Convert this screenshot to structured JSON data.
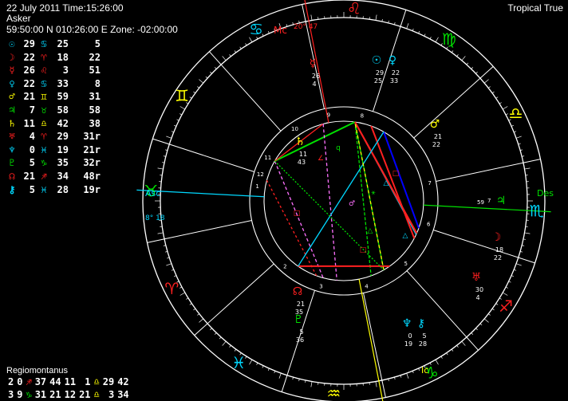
{
  "header": {
    "line1": "22 July 2011 Time:15:26:00",
    "line2": "Asker",
    "line3": "59:50:00 N 010:26:00 E Zone: -02:00:00",
    "zodiac": "Tropical True"
  },
  "colors": {
    "background": "#000000",
    "cyan": "#00d8ff",
    "red": "#ff2020",
    "yellow": "#ffff00",
    "green": "#00e000",
    "pink": "#ff70ff",
    "white": "#ffffff"
  },
  "planets": [
    {
      "glyph": "☉",
      "name": "sun-icon",
      "color": "#00d8ff",
      "deg": "29",
      "sign": "♋",
      "sign_color": "#00d8ff",
      "min": "25",
      "sec": "5"
    },
    {
      "glyph": "☽",
      "name": "moon-icon",
      "color": "#ff2020",
      "deg": "22",
      "sign": "♈",
      "sign_color": "#ff2020",
      "min": "18",
      "sec": "22"
    },
    {
      "glyph": "☿",
      "name": "mercury-icon",
      "color": "#ff2020",
      "deg": "26",
      "sign": "♌",
      "sign_color": "#ff2020",
      "min": "3",
      "sec": "51"
    },
    {
      "glyph": "♀",
      "name": "venus-icon",
      "color": "#00d8ff",
      "deg": "22",
      "sign": "♋",
      "sign_color": "#00d8ff",
      "min": "33",
      "sec": "8"
    },
    {
      "glyph": "♂",
      "name": "mars-icon",
      "color": "#ffff00",
      "deg": "21",
      "sign": "♊",
      "sign_color": "#ffff00",
      "min": "59",
      "sec": "31"
    },
    {
      "glyph": "♃",
      "name": "jupiter-icon",
      "color": "#00e000",
      "deg": "7",
      "sign": "♉",
      "sign_color": "#00e000",
      "min": "58",
      "sec": "58"
    },
    {
      "glyph": "♄",
      "name": "saturn-icon",
      "color": "#ffff00",
      "deg": "11",
      "sign": "♎",
      "sign_color": "#ffff00",
      "min": "42",
      "sec": "38"
    },
    {
      "glyph": "♅",
      "name": "uranus-icon",
      "color": "#ff2020",
      "deg": "4",
      "sign": "♈",
      "sign_color": "#ff2020",
      "min": "29",
      "sec": "31r"
    },
    {
      "glyph": "♆",
      "name": "neptune-icon",
      "color": "#00d8ff",
      "deg": "0",
      "sign": "♓",
      "sign_color": "#00d8ff",
      "min": "19",
      "sec": "21r"
    },
    {
      "glyph": "♇",
      "name": "pluto-icon",
      "color": "#00e000",
      "deg": "5",
      "sign": "♑",
      "sign_color": "#00e000",
      "min": "35",
      "sec": "32r"
    },
    {
      "glyph": "☊",
      "name": "node-icon",
      "color": "#ff2020",
      "deg": "21",
      "sign": "♐",
      "sign_color": "#ff2020",
      "min": "34",
      "sec": "48r"
    },
    {
      "glyph": "⚷",
      "name": "chiron-icon",
      "color": "#00d8ff",
      "deg": "5",
      "sign": "♓",
      "sign_color": "#00d8ff",
      "min": "28",
      "sec": "19r"
    }
  ],
  "house_system": "Regiomontanus",
  "cusps": [
    [
      {
        "t": "2",
        "c": "#ffffff"
      },
      {
        "t": "0",
        "c": "#ffffff"
      },
      {
        "t": "♐",
        "c": "#ff2020"
      },
      {
        "t": "37",
        "c": "#ffffff"
      },
      {
        "t": "44",
        "c": "#ffffff"
      },
      {
        "t": "11",
        "c": "#ffffff"
      },
      {
        "t": "1",
        "c": "#ffffff"
      },
      {
        "t": "♎",
        "c": "#ffff00"
      },
      {
        "t": "29",
        "c": "#ffffff"
      },
      {
        "t": "42",
        "c": "#ffffff"
      }
    ],
    [
      {
        "t": "3",
        "c": "#ffffff"
      },
      {
        "t": "9",
        "c": "#ffffff"
      },
      {
        "t": "♑",
        "c": "#00e000"
      },
      {
        "t": "31",
        "c": "#ffffff"
      },
      {
        "t": "21",
        "c": "#ffffff"
      },
      {
        "t": "12",
        "c": "#ffffff"
      },
      {
        "t": "21",
        "c": "#ffffff"
      },
      {
        "t": "♎",
        "c": "#ffff00"
      },
      {
        "t": "3",
        "c": "#ffffff"
      },
      {
        "t": "34",
        "c": "#ffffff"
      }
    ]
  ],
  "chart": {
    "mc_label": "Mc",
    "mc_pos": "20° 47",
    "asc_label": "Asc",
    "asc_pos": "8° 18",
    "des_label": "Des",
    "ic_label": "Ic",
    "des_deg": "59",
    "des_min": "7",
    "zodiac_signs": [
      {
        "g": "♌",
        "c": "#ff2020",
        "name": "leo-sign-icon"
      },
      {
        "g": "♋",
        "c": "#00d8ff",
        "name": "cancer-sign-icon"
      },
      {
        "g": "♊",
        "c": "#ffff00",
        "name": "gemini-sign-icon"
      },
      {
        "g": "♉",
        "c": "#00e000",
        "name": "taurus-sign-icon"
      },
      {
        "g": "♈",
        "c": "#ff2020",
        "name": "aries-sign-icon"
      },
      {
        "g": "♓",
        "c": "#00d8ff",
        "name": "pisces-sign-icon"
      },
      {
        "g": "♒",
        "c": "#ffff00",
        "name": "aquarius-sign-icon"
      },
      {
        "g": "♑",
        "c": "#00e000",
        "name": "capricorn-sign-icon"
      },
      {
        "g": "♐",
        "c": "#ff2020",
        "name": "sagittarius-sign-icon"
      },
      {
        "g": "♏",
        "c": "#00d8ff",
        "name": "scorpio-sign-icon"
      },
      {
        "g": "♎",
        "c": "#ffff00",
        "name": "libra-sign-icon"
      },
      {
        "g": "♍",
        "c": "#00e000",
        "name": "virgo-sign-icon"
      }
    ],
    "house_numbers": [
      "1",
      "2",
      "3",
      "4",
      "5",
      "6",
      "7",
      "8",
      "9",
      "10",
      "11",
      "12"
    ],
    "wheel_planets": [
      {
        "g": "☿",
        "c": "#ff2020",
        "name": "wheel-mercury",
        "deg": "26",
        "min": "4"
      },
      {
        "g": "☉",
        "c": "#00d8ff",
        "name": "wheel-sun",
        "deg": "29",
        "min": "25"
      },
      {
        "g": "♀",
        "c": "#00d8ff",
        "name": "wheel-venus",
        "deg": "22",
        "min": "33"
      },
      {
        "g": "♂",
        "c": "#ffff00",
        "name": "wheel-mars",
        "deg": "21",
        "min": "22",
        "extra": "35",
        "extra2": "0"
      },
      {
        "g": "♄",
        "c": "#ffff00",
        "name": "wheel-saturn",
        "deg": "11",
        "min": "43"
      },
      {
        "g": "♃",
        "c": "#00e000",
        "name": "wheel-jupiter",
        "deg": "",
        "min": ""
      },
      {
        "g": "☽",
        "c": "#ff2020",
        "name": "wheel-moon",
        "deg": "18",
        "min": "22"
      },
      {
        "g": "♅",
        "c": "#ff2020",
        "name": "wheel-uranus",
        "deg": "30",
        "min": "4"
      },
      {
        "g": "♆",
        "c": "#00d8ff",
        "name": "wheel-neptune",
        "deg": "0",
        "min": "19"
      },
      {
        "g": "⚷",
        "c": "#00d8ff",
        "name": "wheel-chiron",
        "deg": "5",
        "min": "28"
      },
      {
        "g": "♇",
        "c": "#00e000",
        "name": "wheel-pluto",
        "deg": "5",
        "min": "36"
      },
      {
        "g": "☊",
        "c": "#ff2020",
        "name": "wheel-node",
        "deg": "21",
        "min": "35"
      }
    ]
  }
}
